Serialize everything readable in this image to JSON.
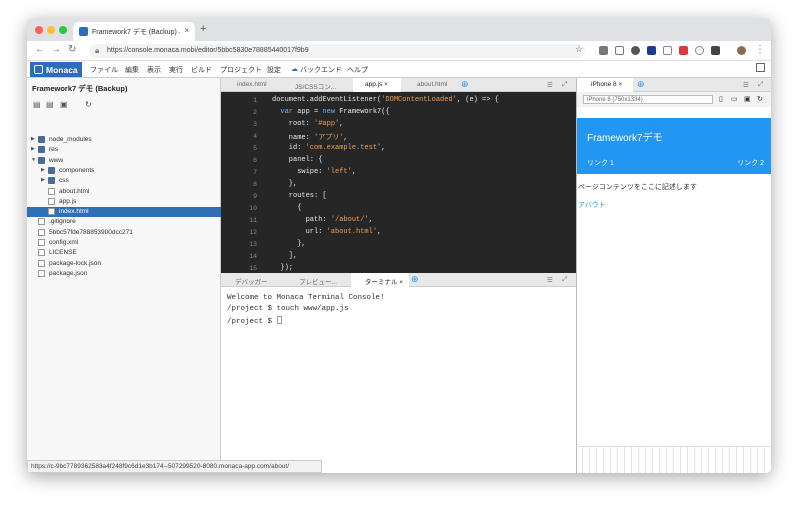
{
  "browser": {
    "tab_title": "Framework7 デモ (Backup) — M",
    "url": "https://console.monaca.mobi/editor/5bbc5830e78885440017f9b9",
    "status_url": "https://c-9bc7789362583a4f248f9c6d1e3b174--507299520-8080.monaca-app.com/about/"
  },
  "menu": {
    "logo": "Monaca",
    "items": [
      "ファイル",
      "編集",
      "表示",
      "実行",
      "ビルド",
      "プロジェクト",
      "設定",
      "バックエンド",
      "ヘルプ"
    ]
  },
  "sidebar": {
    "project_title": "Framework7 デモ (Backup)",
    "tree": [
      {
        "label": "node_modules",
        "type": "folder",
        "depth": 0,
        "arrow": "▶"
      },
      {
        "label": "res",
        "type": "folder",
        "depth": 0,
        "arrow": "▶"
      },
      {
        "label": "www",
        "type": "folder",
        "depth": 0,
        "arrow": "▼"
      },
      {
        "label": "components",
        "type": "folder",
        "depth": 1,
        "arrow": "▶"
      },
      {
        "label": "css",
        "type": "folder",
        "depth": 1,
        "arrow": "▶"
      },
      {
        "label": "about.html",
        "type": "file",
        "depth": 1,
        "arrow": ""
      },
      {
        "label": "app.js",
        "type": "file",
        "depth": 1,
        "arrow": ""
      },
      {
        "label": "index.html",
        "type": "file",
        "depth": 1,
        "arrow": "",
        "selected": true
      },
      {
        "label": ".gitignore",
        "type": "file",
        "depth": 0,
        "arrow": ""
      },
      {
        "label": "5bbc57fde788853900dcc271",
        "type": "file",
        "depth": 0,
        "arrow": ""
      },
      {
        "label": "config.xml",
        "type": "file",
        "depth": 0,
        "arrow": ""
      },
      {
        "label": "LICENSE",
        "type": "file",
        "depth": 0,
        "arrow": ""
      },
      {
        "label": "package-lock.json",
        "type": "file",
        "depth": 0,
        "arrow": ""
      },
      {
        "label": "package.json",
        "type": "file",
        "depth": 0,
        "arrow": ""
      }
    ]
  },
  "editor": {
    "tabs": [
      "index.html",
      "JS/CSSコン...",
      "app.js",
      "about.html"
    ],
    "active_tab": "app.js",
    "line_numbers": [
      "1",
      "2",
      "3",
      "4",
      "5",
      "6",
      "7",
      "8",
      "9",
      "10",
      "11",
      "12",
      "13",
      "14",
      "15"
    ]
  },
  "bottom": {
    "tabs": [
      "デバッガー",
      "プレビュー...",
      "ターミナル"
    ],
    "active_tab": "ターミナル",
    "lines": [
      "Welcome to Monaca Terminal Console!",
      "/project $ touch www/app.js",
      "/project $ "
    ]
  },
  "preview": {
    "tab": "iPhone 8",
    "device": "iPhone 8 (750x1334)",
    "app_title": "Framework7デモ",
    "link1": "リンク 1",
    "link2": "リンク 2",
    "content": "ページコンテンツをここに記述します",
    "about_link": "アバウト"
  },
  "colors": {
    "accent": "#2196f3",
    "monaca_blue": "#2a6ebb",
    "editor_bg": "#262626"
  }
}
